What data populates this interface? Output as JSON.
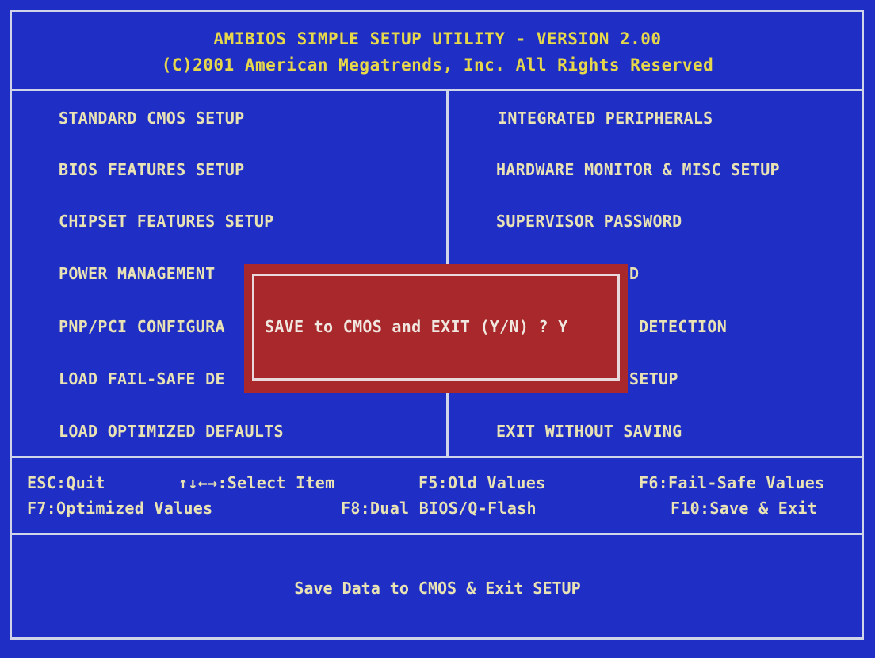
{
  "header": {
    "title": "AMIBIOS SIMPLE SETUP UTILITY - VERSION 2.00",
    "copyright": "(C)2001 American Megatrends, Inc. All Rights Reserved"
  },
  "menu_left": [
    "STANDARD CMOS SETUP",
    "BIOS FEATURES SETUP",
    "CHIPSET FEATURES SETUP",
    "POWER MANAGEMENT",
    "PNP/PCI CONFIGURA",
    "LOAD FAIL-SAFE DE",
    "LOAD OPTIMIZED DEFAULTS"
  ],
  "menu_right": [
    "INTEGRATED PERIPHERALS",
    "HARDWARE MONITOR & MISC SETUP",
    "SUPERVISOR PASSWORD",
    "D",
    "DETECTION",
    "SETUP",
    "EXIT WITHOUT SAVING"
  ],
  "keys": {
    "esc": "ESC:Quit",
    "select": "↑↓←→:Select Item",
    "f5": "F5:Old Values",
    "f6": "F6:Fail-Safe Values",
    "f7": "F7:Optimized Values",
    "f8": "F8:Dual BIOS/Q-Flash",
    "f10": "F10:Save & Exit"
  },
  "status_hint": "Save Data to CMOS & Exit SETUP",
  "dialog": {
    "prompt": "SAVE to CMOS and EXIT (Y/N) ? Y"
  }
}
